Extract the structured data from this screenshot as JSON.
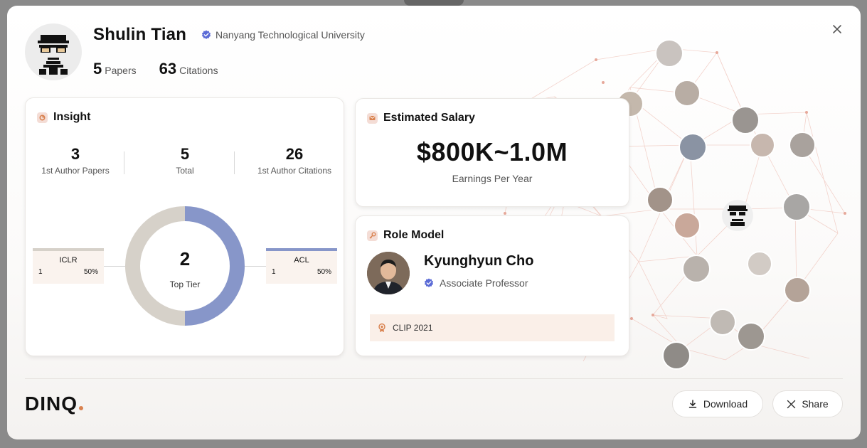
{
  "profile": {
    "name": "Shulin Tian",
    "affiliation": "Nanyang Technological University",
    "papers_count": "5",
    "papers_label": "Papers",
    "citations_count": "63",
    "citations_label": "Citations"
  },
  "insight": {
    "title": "Insight",
    "stats": [
      {
        "value": "3",
        "label": "1st Author Papers"
      },
      {
        "value": "5",
        "label": "Total"
      },
      {
        "value": "26",
        "label": "1st Author Citations"
      }
    ],
    "donut": {
      "value": "2",
      "label": "Top Tier"
    },
    "venues": [
      {
        "name": "ICLR",
        "count": "1",
        "percent": "50%",
        "color": "#d6d1c9"
      },
      {
        "name": "ACL",
        "count": "1",
        "percent": "50%",
        "color": "#8796c9"
      }
    ]
  },
  "salary": {
    "title": "Estimated Salary",
    "value": "$800K~1.0M",
    "subtitle": "Earnings Per Year"
  },
  "role_model": {
    "title": "Role Model",
    "name": "Kyunghyun Cho",
    "position": "Associate Professor",
    "tag": "CLIP 2021"
  },
  "footer": {
    "logo": "DINQ",
    "download_label": "Download",
    "share_label": "Share"
  },
  "colors": {
    "accent": "#d9824f",
    "verified": "#5b6bd6",
    "donut_blue": "#8796c9",
    "donut_gray": "#d6d1c9"
  }
}
